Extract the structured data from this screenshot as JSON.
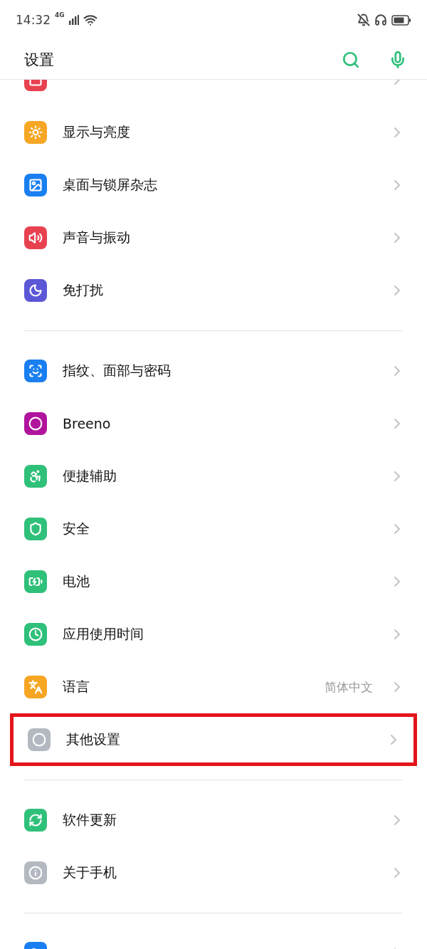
{
  "status_bar": {
    "time": "14:32",
    "network": "4G"
  },
  "header": {
    "title": "设置"
  },
  "groups": [
    {
      "items": [
        {
          "color": "#e8414f",
          "highlighted": false
        },
        {
          "label": "显示与亮度",
          "color": "#f6a623",
          "highlighted": false
        },
        {
          "label": "桌面与锁屏杂志",
          "color": "#1a7ff0",
          "highlighted": false
        },
        {
          "label": "声音与振动",
          "color": "#e8414f",
          "highlighted": false
        },
        {
          "label": "免打扰",
          "color": "#5b57d6",
          "highlighted": false
        }
      ]
    },
    {
      "items": [
        {
          "label": "指纹、面部与密码",
          "color": "#1a7ff0",
          "highlighted": false
        },
        {
          "label": "Breeno",
          "color": "#b0139c",
          "highlighted": false
        },
        {
          "label": "便捷辅助",
          "color": "#2fc07a",
          "highlighted": false
        },
        {
          "label": "安全",
          "color": "#2fc07a",
          "highlighted": false
        },
        {
          "label": "电池",
          "color": "#2fc07a",
          "highlighted": false
        },
        {
          "label": "应用使用时间",
          "color": "#2fc07a",
          "highlighted": false
        },
        {
          "label": "语言",
          "value": "简体中文",
          "color": "#f6a623",
          "highlighted": false
        },
        {
          "label": "其他设置",
          "color": "#b4b8c0",
          "highlighted": true
        }
      ]
    },
    {
      "items": [
        {
          "label": "软件更新",
          "color": "#2fc07a",
          "highlighted": false
        },
        {
          "label": "关于手机",
          "color": "#b4b8c0",
          "highlighted": false
        }
      ]
    },
    {
      "items": [
        {
          "color": "#1a7ff0",
          "highlighted": false
        }
      ]
    }
  ]
}
